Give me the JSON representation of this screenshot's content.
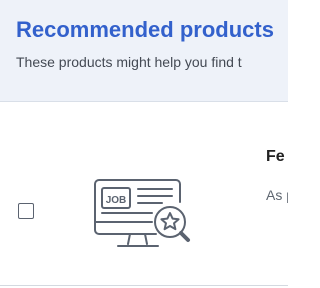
{
  "header": {
    "title": "Recommended products",
    "subtitle": "These products might help you find t"
  },
  "products": [
    {
      "name": "Fe",
      "description": "As pro var",
      "image_label": "JOB",
      "image_icon": "job-posting-monitor-icon",
      "checked": false
    }
  ],
  "colors": {
    "accent": "#3361cc",
    "header_bg": "#eef2f9",
    "icon": "#5b6370"
  }
}
